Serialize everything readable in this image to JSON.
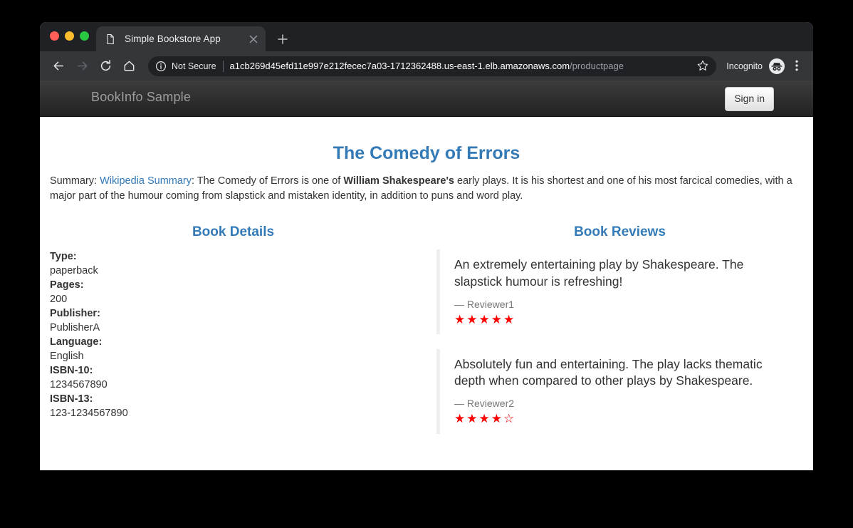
{
  "browser": {
    "tab": {
      "title": "Simple Bookstore App",
      "favicon_icon": "document-icon",
      "close_icon": "close-icon"
    },
    "new_tab_icon": "plus-icon",
    "toolbar": {
      "back_icon": "back-arrow-icon",
      "forward_icon": "forward-arrow-icon",
      "reload_icon": "reload-icon",
      "home_icon": "home-icon",
      "info_icon": "info-circle-icon",
      "security_label": "Not Secure",
      "url_host": "a1cb269d45efd11e997e212fecec7a03-1712362488.us-east-1.elb.amazonaws.com",
      "url_path": "/productpage",
      "bookmark_icon": "star-outline-icon",
      "incognito_label": "Incognito",
      "incognito_icon": "incognito-icon",
      "menu_icon": "three-dots-vertical-icon"
    },
    "window_controls": {
      "close": "close-traffic-light",
      "minimize": "minimize-traffic-light",
      "maximize": "maximize-traffic-light"
    }
  },
  "colors": {
    "accent_blue": "#337ab7",
    "star_red": "#ff0000",
    "navbar_dark": "#222222",
    "muted_text": "#777777"
  },
  "page": {
    "navbar": {
      "brand": "BookInfo Sample",
      "signin_label": "Sign in"
    },
    "book_title": "The Comedy of Errors",
    "summary": {
      "prefix": "Summary: ",
      "link_text": "Wikipedia Summary",
      "part1": ": The Comedy of Errors is one of ",
      "bold": "William Shakespeare's",
      "part2": " early plays. It is his shortest and one of his most farcical comedies, with a major part of the humour coming from slapstick and mistaken identity, in addition to puns and word play."
    },
    "details": {
      "heading": "Book Details",
      "items": [
        {
          "label": "Type:",
          "value": "paperback"
        },
        {
          "label": "Pages:",
          "value": "200"
        },
        {
          "label": "Publisher:",
          "value": "PublisherA"
        },
        {
          "label": "Language:",
          "value": "English"
        },
        {
          "label": "ISBN-10:",
          "value": "1234567890"
        },
        {
          "label": "ISBN-13:",
          "value": "123-1234567890"
        }
      ]
    },
    "reviews": {
      "heading": "Book Reviews",
      "items": [
        {
          "text": "An extremely entertaining play by Shakespeare. The slapstick humour is refreshing!",
          "author": "— Reviewer1",
          "rating": 5,
          "stars": "★★★★★"
        },
        {
          "text": "Absolutely fun and entertaining. The play lacks thematic depth when compared to other plays by Shakespeare.",
          "author": "— Reviewer2",
          "rating": 4,
          "stars": "★★★★☆"
        }
      ]
    }
  }
}
